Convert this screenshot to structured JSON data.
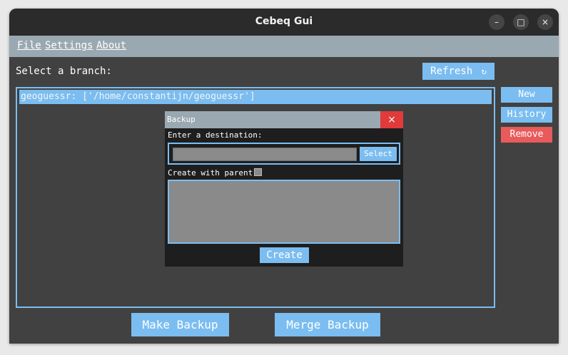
{
  "window": {
    "title": "Cebeq Gui",
    "controls": {
      "minimize": "–",
      "maximize": "□",
      "close": "×"
    }
  },
  "menu": {
    "file": "File",
    "settings": "Settings",
    "about": "About"
  },
  "main": {
    "select_label": "Select a branch:",
    "refresh_label": "Refresh",
    "refresh_icon": "↻",
    "branches": [
      "geoguessr: ['/home/constantijn/geoguessr']"
    ],
    "side_buttons": {
      "new": "New",
      "history": "History",
      "remove": "Remove"
    },
    "bottom_buttons": {
      "make_backup": "Make Backup",
      "merge_backup": "Merge Backup"
    }
  },
  "dialog": {
    "title": "Backup",
    "close": "×",
    "destination_label": "Enter a destination:",
    "destination_value": "",
    "select_label": "Select",
    "parent_label": "Create with parent:",
    "create_label": "Create"
  },
  "colors": {
    "accent": "#7bbdf0",
    "danger": "#e95a5a",
    "background": "#414141",
    "menubar": "#9aa8b1"
  }
}
